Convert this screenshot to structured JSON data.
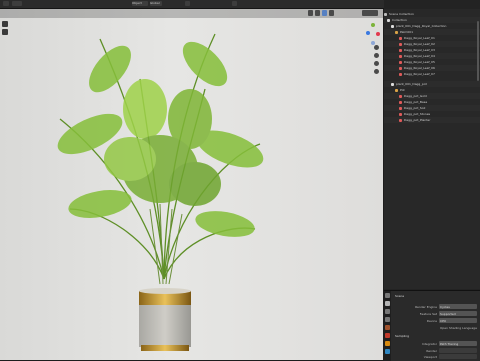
{
  "topbar": {
    "mode_label": "Object",
    "view_label": "Global",
    "scene_label": "Scene"
  },
  "outliner": {
    "rows": [
      "Scene Collection",
      "Collection",
      "plant_001_Dagg_Royal_Collection",
      "Palm001",
      "Dagg_Royal_Leaf_01",
      "Dagg_Royal_Leaf_02",
      "Dagg_Royal_Leaf_03",
      "Dagg_Royal_Leaf_04",
      "Dagg_Royal_Leaf_05",
      "Dagg_Royal_Leaf_06",
      "Dagg_Royal_Leaf_07",
      "plant_001_Dagg_pot",
      "Pot",
      "Dagg_pot_Gold",
      "Dagg_pot_Base",
      "Dagg_pot_Soil",
      "Dagg_pot_Stones",
      "Dagg_pot_Planter"
    ]
  },
  "properties": {
    "section": "Scene",
    "render_engine_label": "Render Engine",
    "render_engine": "Cycles",
    "feature_set_label": "Feature Set",
    "feature_set": "Supported",
    "device_label": "Device",
    "device": "CPU",
    "open_shading_label": "Open Shading Language",
    "sampling_label": "Sampling",
    "integrator_label": "Integrator",
    "integrator": "Path Tracing",
    "render_label": "Render",
    "viewport_label": "Viewport"
  }
}
